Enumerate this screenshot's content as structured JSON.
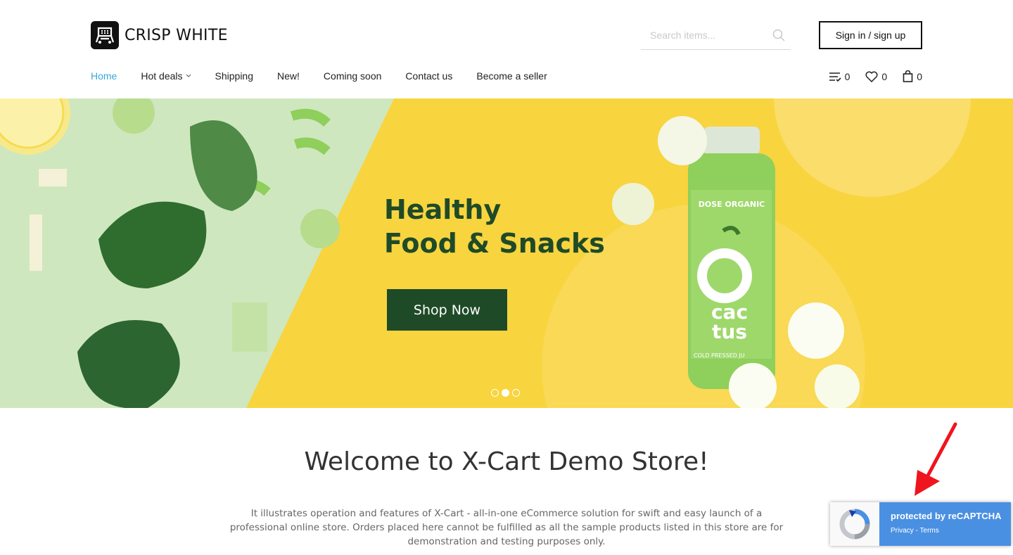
{
  "header": {
    "logo_text": "CRISP WHITE",
    "search_placeholder": "Search items...",
    "signin_label": "Sign in / sign up"
  },
  "nav": {
    "items": [
      {
        "label": "Home",
        "active": true
      },
      {
        "label": "Hot deals",
        "dropdown": true
      },
      {
        "label": "Shipping"
      },
      {
        "label": "New!"
      },
      {
        "label": "Coming soon"
      },
      {
        "label": "Contact us"
      },
      {
        "label": "Become a seller"
      }
    ]
  },
  "counters": {
    "compare": "0",
    "wishlist": "0",
    "cart": "0"
  },
  "banner": {
    "title_line1": "Healthy",
    "title_line2": "Food & Snacks",
    "button_label": "Shop Now",
    "bottle_brand": "DOSE ORGANIC",
    "bottle_name_1": "cac",
    "bottle_name_2": "tus",
    "bottle_sub": "COLD PRESSED JU",
    "slides": 3,
    "active_slide": 2
  },
  "welcome": {
    "title": "Welcome to X-Cart Demo Store!",
    "text": "It illustrates operation and features of X-Cart - all-in-one eCommerce solution for swift and easy launch of a professional online store. Orders placed here cannot be fulfilled as all the sample products listed in this store are for demonstration and testing purposes only."
  },
  "recaptcha": {
    "title": "protected by reCAPTCHA",
    "privacy": "Privacy",
    "separator": " - ",
    "terms": "Terms"
  },
  "colors": {
    "accent": "#39a8d6",
    "banner_yellow": "#f8d43f",
    "banner_green": "#1f4a28",
    "recaptcha_blue": "#4a90e2",
    "arrow_red": "#f0141e"
  }
}
